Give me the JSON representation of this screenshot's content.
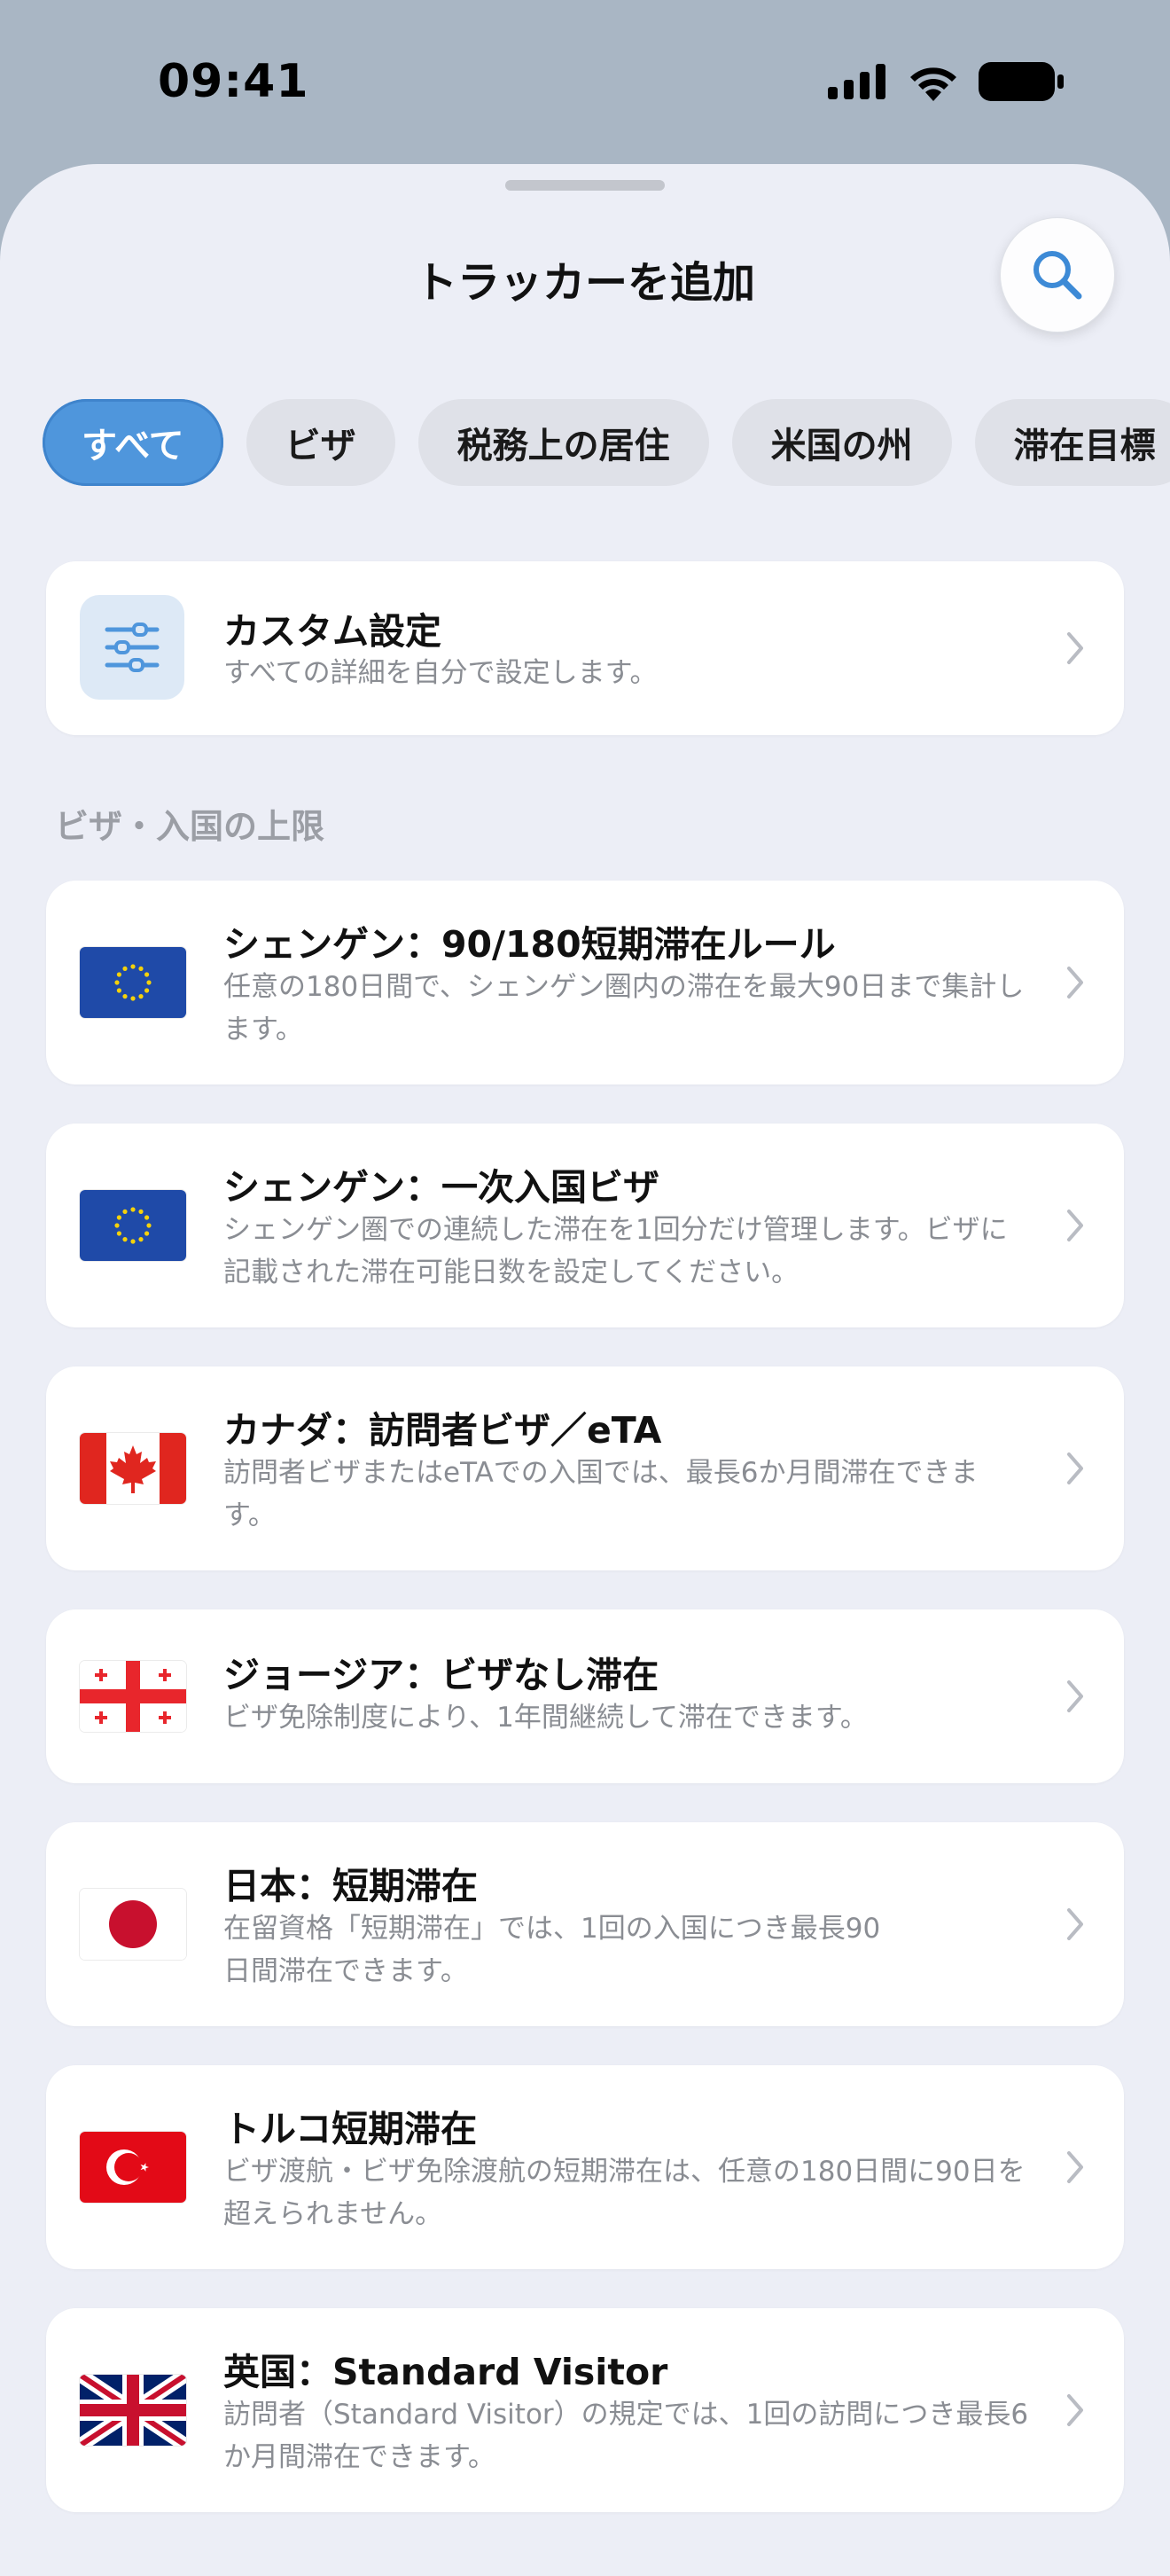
{
  "status": {
    "time": "09:41"
  },
  "sheet": {
    "title": "トラッカーを追加"
  },
  "chips": [
    "すべて",
    "ビザ",
    "税務上の居住",
    "米国の州",
    "滞在目標"
  ],
  "custom": {
    "title": "カスタム設定",
    "desc": "すべての詳細を自分で設定します。"
  },
  "section": {
    "title": "ビザ・入国の上限"
  },
  "items": [
    {
      "title": "シェンゲン：90/180短期滞在ルール",
      "desc": "任意の180日間で、シェンゲン圏内の滞在を最大90日まで集計します。",
      "flag": "eu-flag"
    },
    {
      "title": "シェンゲン：一次入国ビザ",
      "desc": "シェンゲン圏での連続した滞在を1回分だけ管理します。ビザに記載された滞在可能日数を設定してください。",
      "flag": "eu-flag"
    },
    {
      "title": "カナダ：訪問者ビザ／eTA",
      "desc": "訪問者ビザまたはeTAでの入国では、最長6か月間滞在できます。",
      "flag": "canada-flag"
    },
    {
      "title": "ジョージア：ビザなし滞在",
      "desc": "ビザ免除制度により、1年間継続して滞在できます。",
      "flag": "georgia-flag"
    },
    {
      "title": "日本：短期滞在",
      "desc": "在留資格「短期滞在」では、1回の入国につき最長90日間滞在できます。",
      "flag": "japan-flag"
    },
    {
      "title": "トルコ短期滞在",
      "desc": "ビザ渡航・ビザ免除渡航の短期滞在は、任意の180日間に90日を超えられません。",
      "flag": "turkey-flag"
    },
    {
      "title": "英国：Standard Visitor",
      "desc": "訪問者（Standard Visitor）の規定では、1回の訪問につき最長6か月間滞在できます。",
      "flag": "uk-flag"
    }
  ],
  "colors": {
    "accent": "#4f96dc",
    "background": "#eceef6"
  }
}
